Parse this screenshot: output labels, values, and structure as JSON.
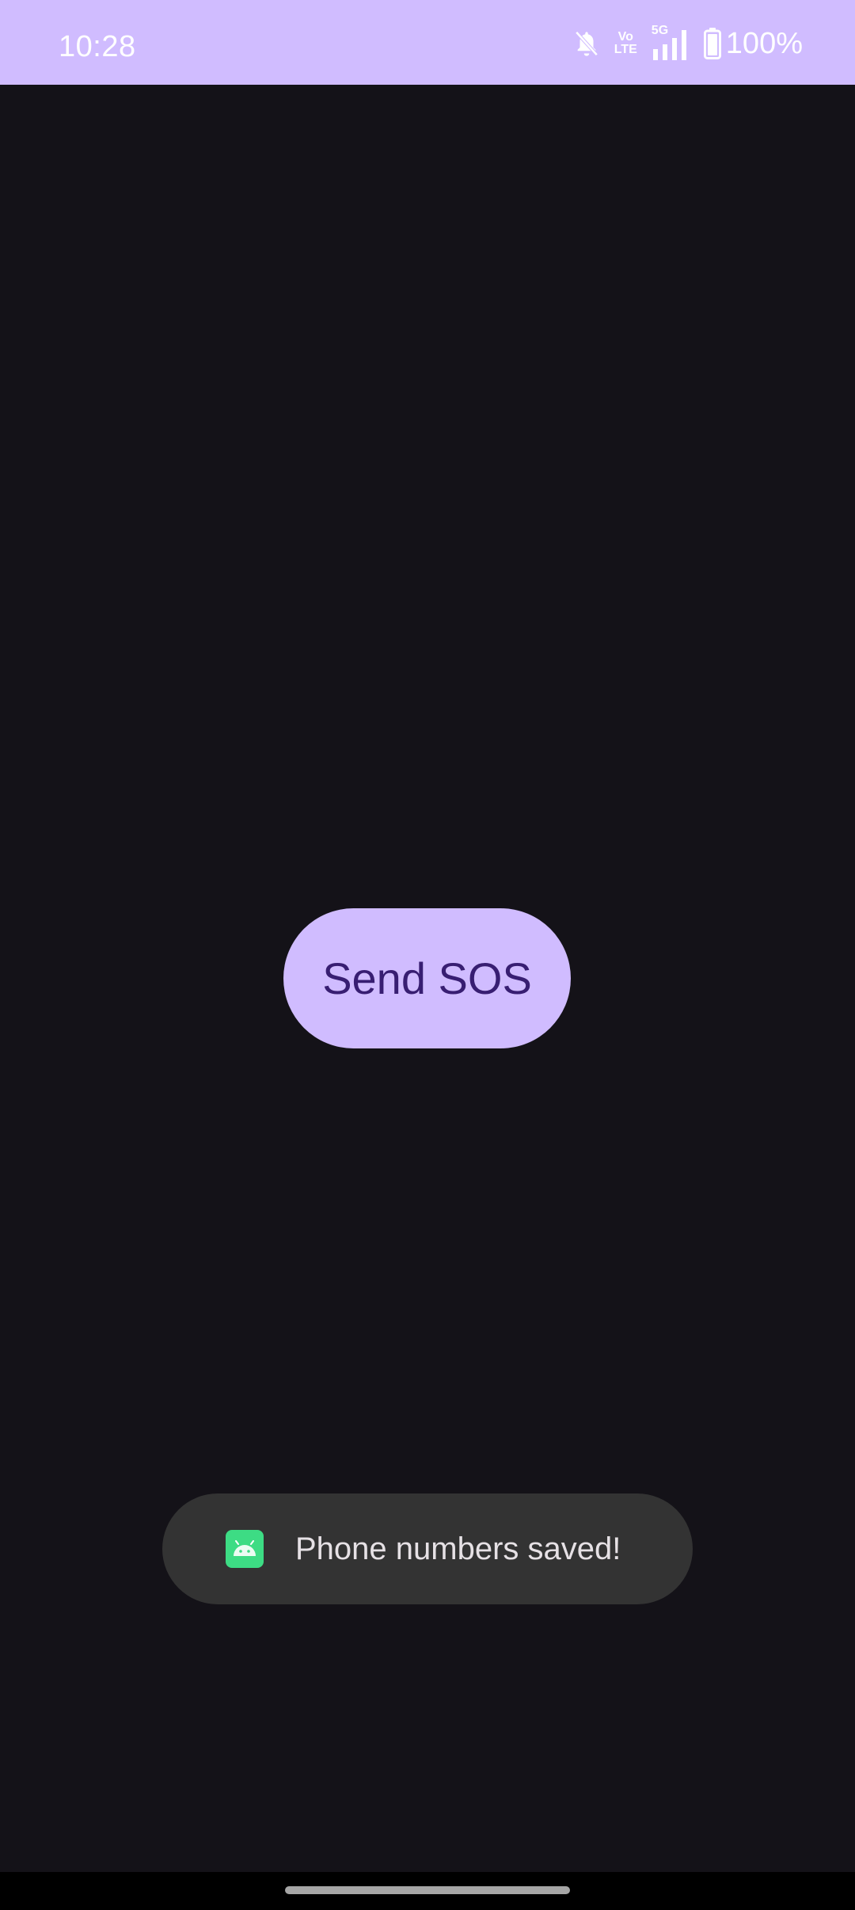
{
  "status_bar": {
    "time": "10:28",
    "network_top": "5G",
    "volte_top": "Vo",
    "volte_bottom": "LTE",
    "battery_percent": "100%",
    "icons": [
      "bell-off-icon",
      "volte-icon",
      "signal-icon",
      "battery-icon"
    ]
  },
  "main": {
    "sos_button_label": "Send SOS"
  },
  "toast": {
    "message": "Phone numbers saved!",
    "icon": "android-app-icon"
  },
  "colors": {
    "primary": "#d0bcff",
    "on_primary": "#381e72",
    "background": "#141218",
    "toast_bg": "#333333",
    "android_green": "#3ddc84"
  }
}
